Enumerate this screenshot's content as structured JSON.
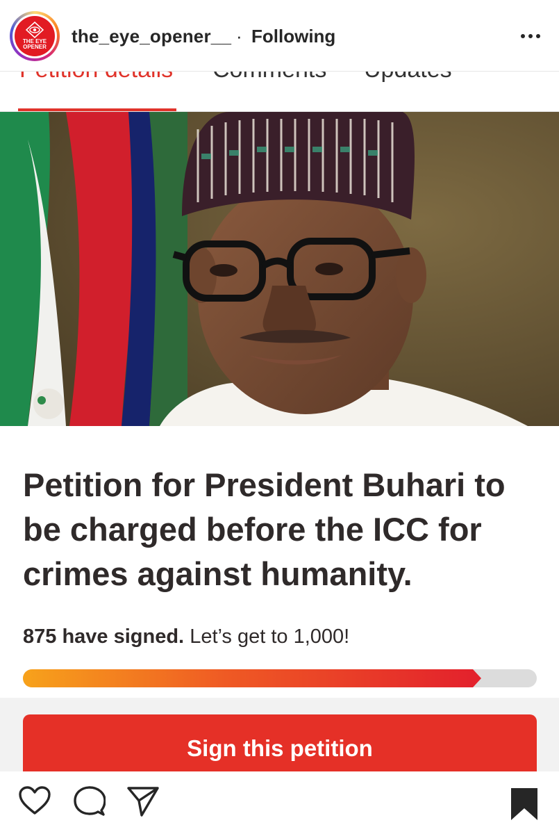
{
  "post_header": {
    "avatar_text": "THE EYE OPENER",
    "username": "the_eye_opener__",
    "separator": "·",
    "follow_status": "Following",
    "more_icon": "more-horizontal-icon"
  },
  "petition": {
    "tabs": [
      {
        "label": "Petition details",
        "active": true
      },
      {
        "label": "Comments",
        "active": false
      },
      {
        "label": "Updates",
        "active": false
      }
    ],
    "title": "Petition for President Buhari to be charged before the ICC for crimes against humanity.",
    "signed_count_text": "875 have signed.",
    "goal_text": "Let’s get to 1,000!",
    "signed": 875,
    "goal": 1000,
    "sign_button": "Sign this petition"
  },
  "actions": {
    "like_icon": "heart-icon",
    "comment_icon": "comment-icon",
    "share_icon": "send-icon",
    "save_icon": "bookmark-icon"
  },
  "colors": {
    "accent": "#e53027",
    "progress_start": "#f7a21b",
    "progress_end": "#e3222c"
  }
}
